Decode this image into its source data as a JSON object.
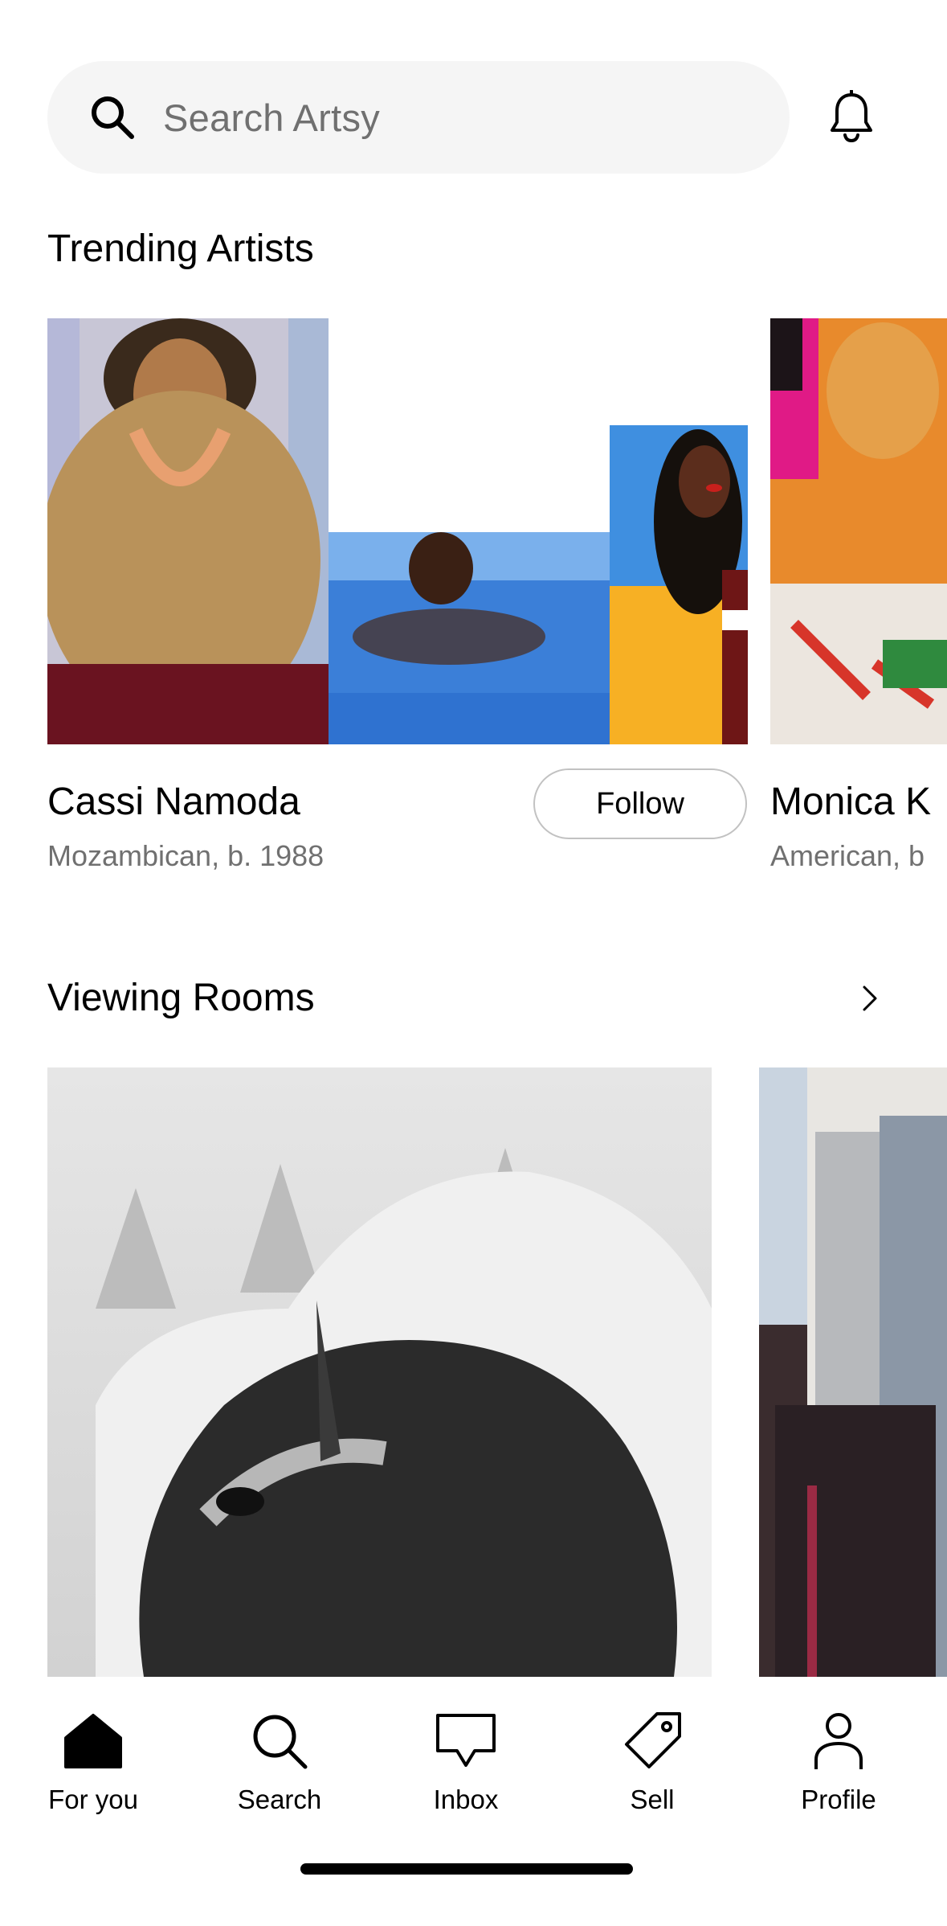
{
  "search": {
    "placeholder": "Search Artsy"
  },
  "trending": {
    "title": "Trending Artists",
    "artists": [
      {
        "name": "Cassi Namoda",
        "meta": "Mozambican, b. 1988",
        "follow_label": "Follow"
      },
      {
        "name": "Monica K",
        "meta": "American, b"
      }
    ]
  },
  "viewing_rooms": {
    "title": "Viewing Rooms"
  },
  "tabbar": {
    "tabs": [
      {
        "label": "For you",
        "icon": "home-icon"
      },
      {
        "label": "Search",
        "icon": "search-icon"
      },
      {
        "label": "Inbox",
        "icon": "inbox-icon"
      },
      {
        "label": "Sell",
        "icon": "tag-icon"
      },
      {
        "label": "Profile",
        "icon": "person-icon"
      }
    ]
  }
}
